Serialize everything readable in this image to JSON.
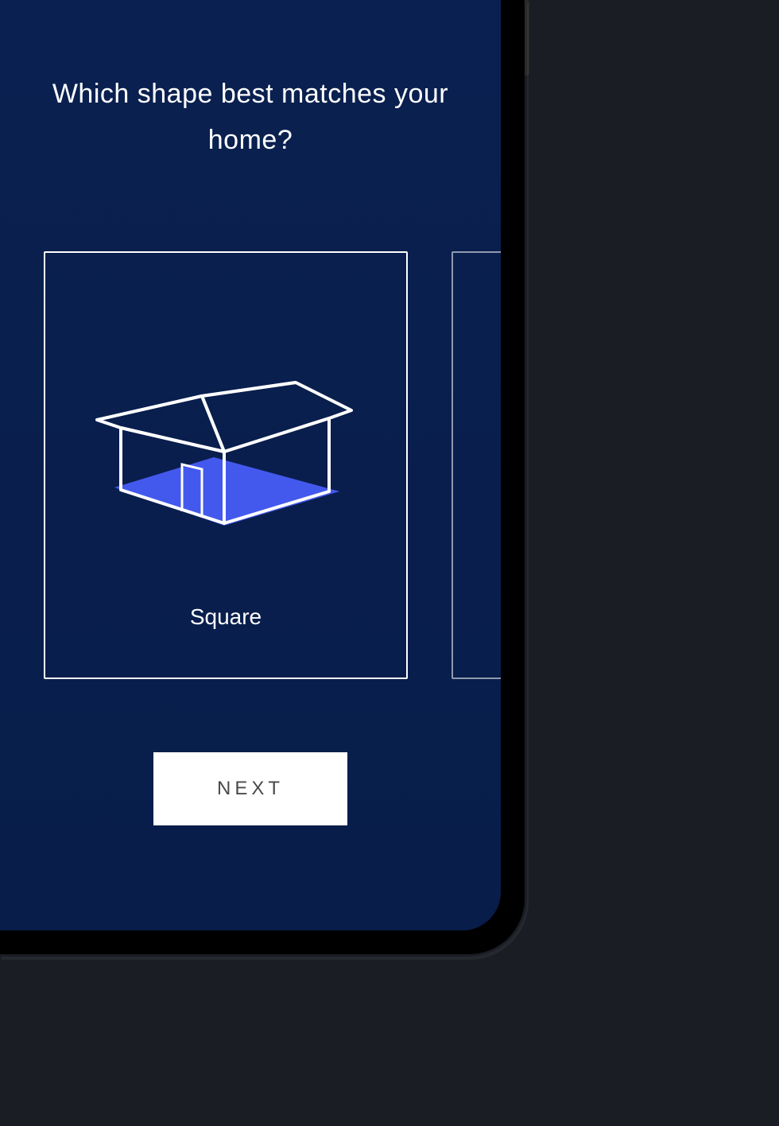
{
  "question": "Which shape best matches your home?",
  "shapes": [
    {
      "label": "Square",
      "selected": true
    }
  ],
  "button": {
    "label": "NEXT"
  },
  "colors": {
    "background": "#1a1d23",
    "screen": "#0a2050",
    "card_border": "#ffffff",
    "floor_highlight": "#4a5fff",
    "button_bg": "#ffffff",
    "button_text": "#4a4a4a"
  }
}
